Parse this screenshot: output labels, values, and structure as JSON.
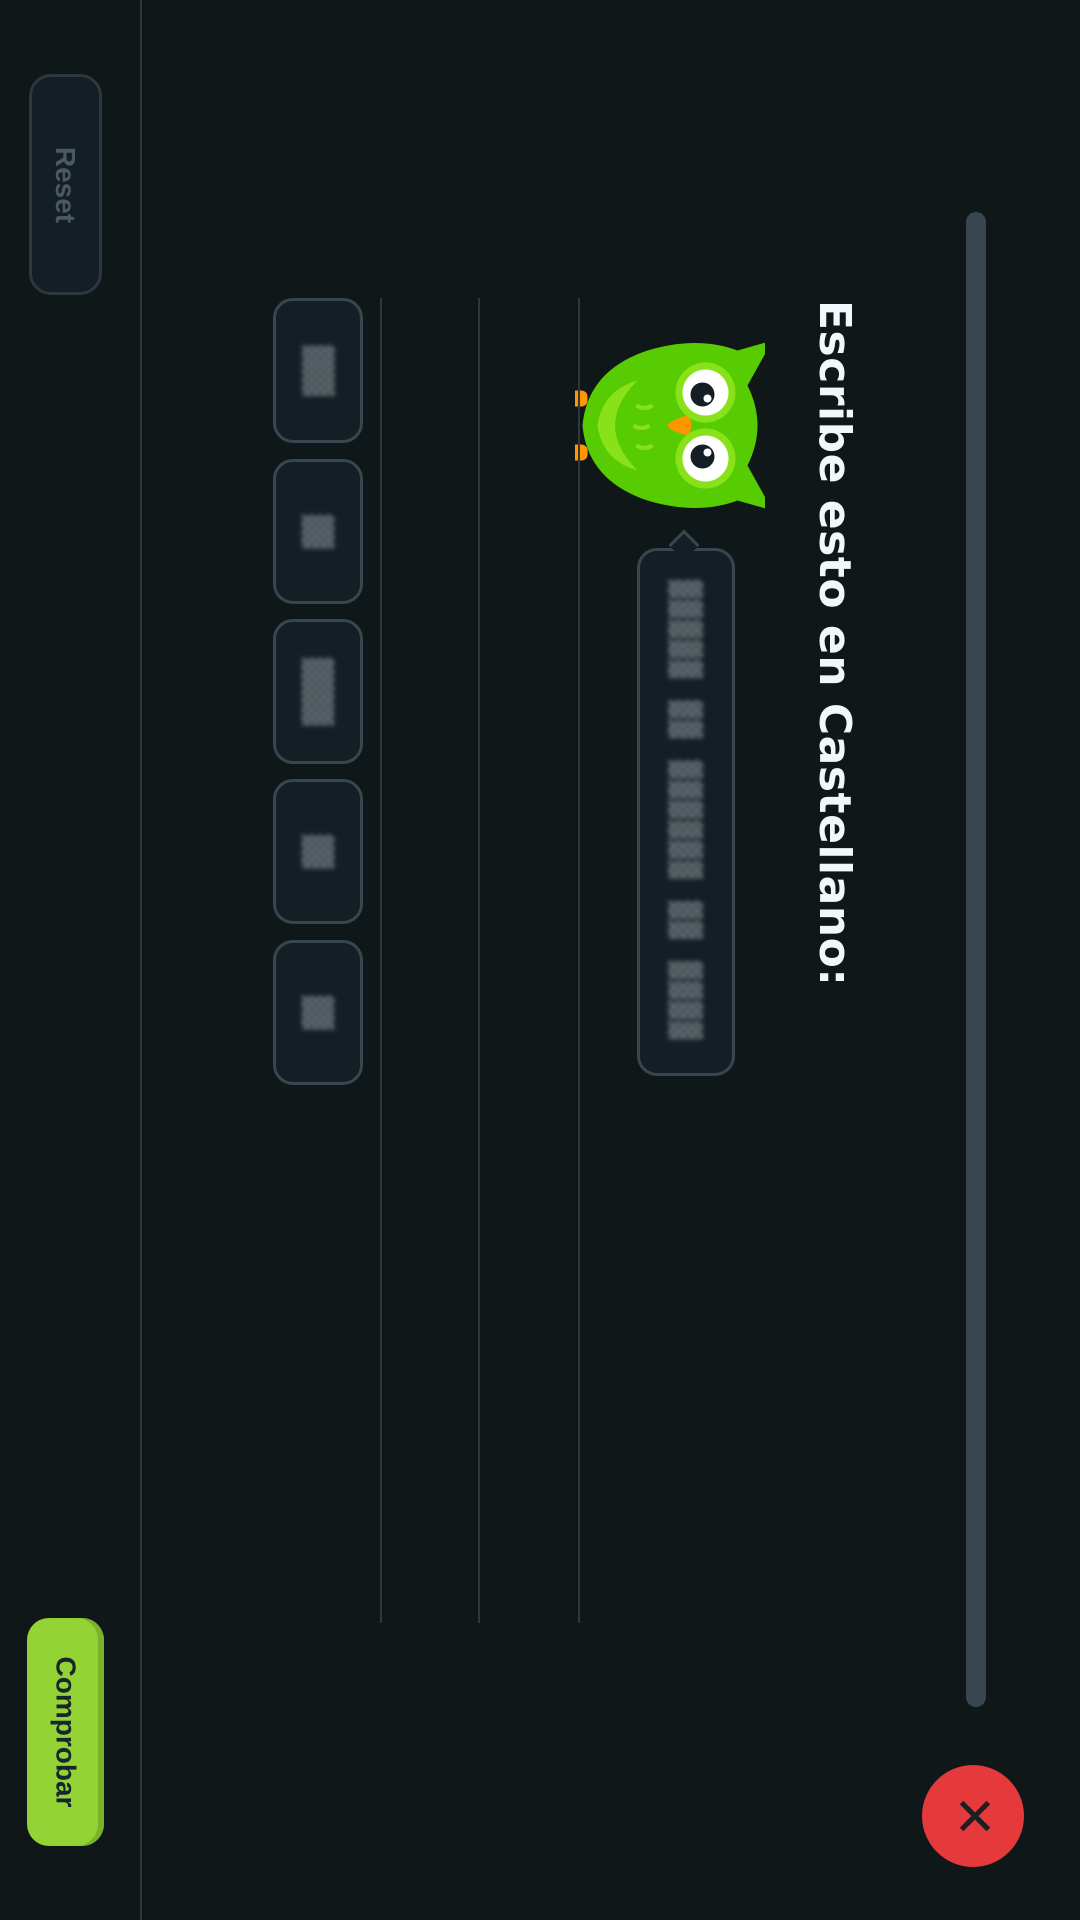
{
  "header": {
    "progress": 0,
    "close_label": "✕"
  },
  "prompt": {
    "title": "Escribe esto en Castellano:",
    "sentence": "▓▓▓▓▓ ▓▓ ▓▓▓▓▓▓ ▓▓ ▓▓▓▓"
  },
  "mascot": {
    "icon": "owl-mascot-icon",
    "colors": {
      "body": "#58cc02",
      "belly": "#89e219",
      "beak": "#ff9600"
    }
  },
  "word_bank": {
    "tiles": [
      {
        "label": "▓▓▓"
      },
      {
        "label": "▓▓"
      },
      {
        "label": "▓▓▓▓"
      },
      {
        "label": "▓▓"
      },
      {
        "label": "▓▓"
      }
    ]
  },
  "footer": {
    "reset_label": "Reset",
    "check_label": "Comprobar"
  },
  "colors": {
    "background": "#101719",
    "close_button": "#e5393c",
    "check_button": "#93d334",
    "border": "#37464f"
  }
}
